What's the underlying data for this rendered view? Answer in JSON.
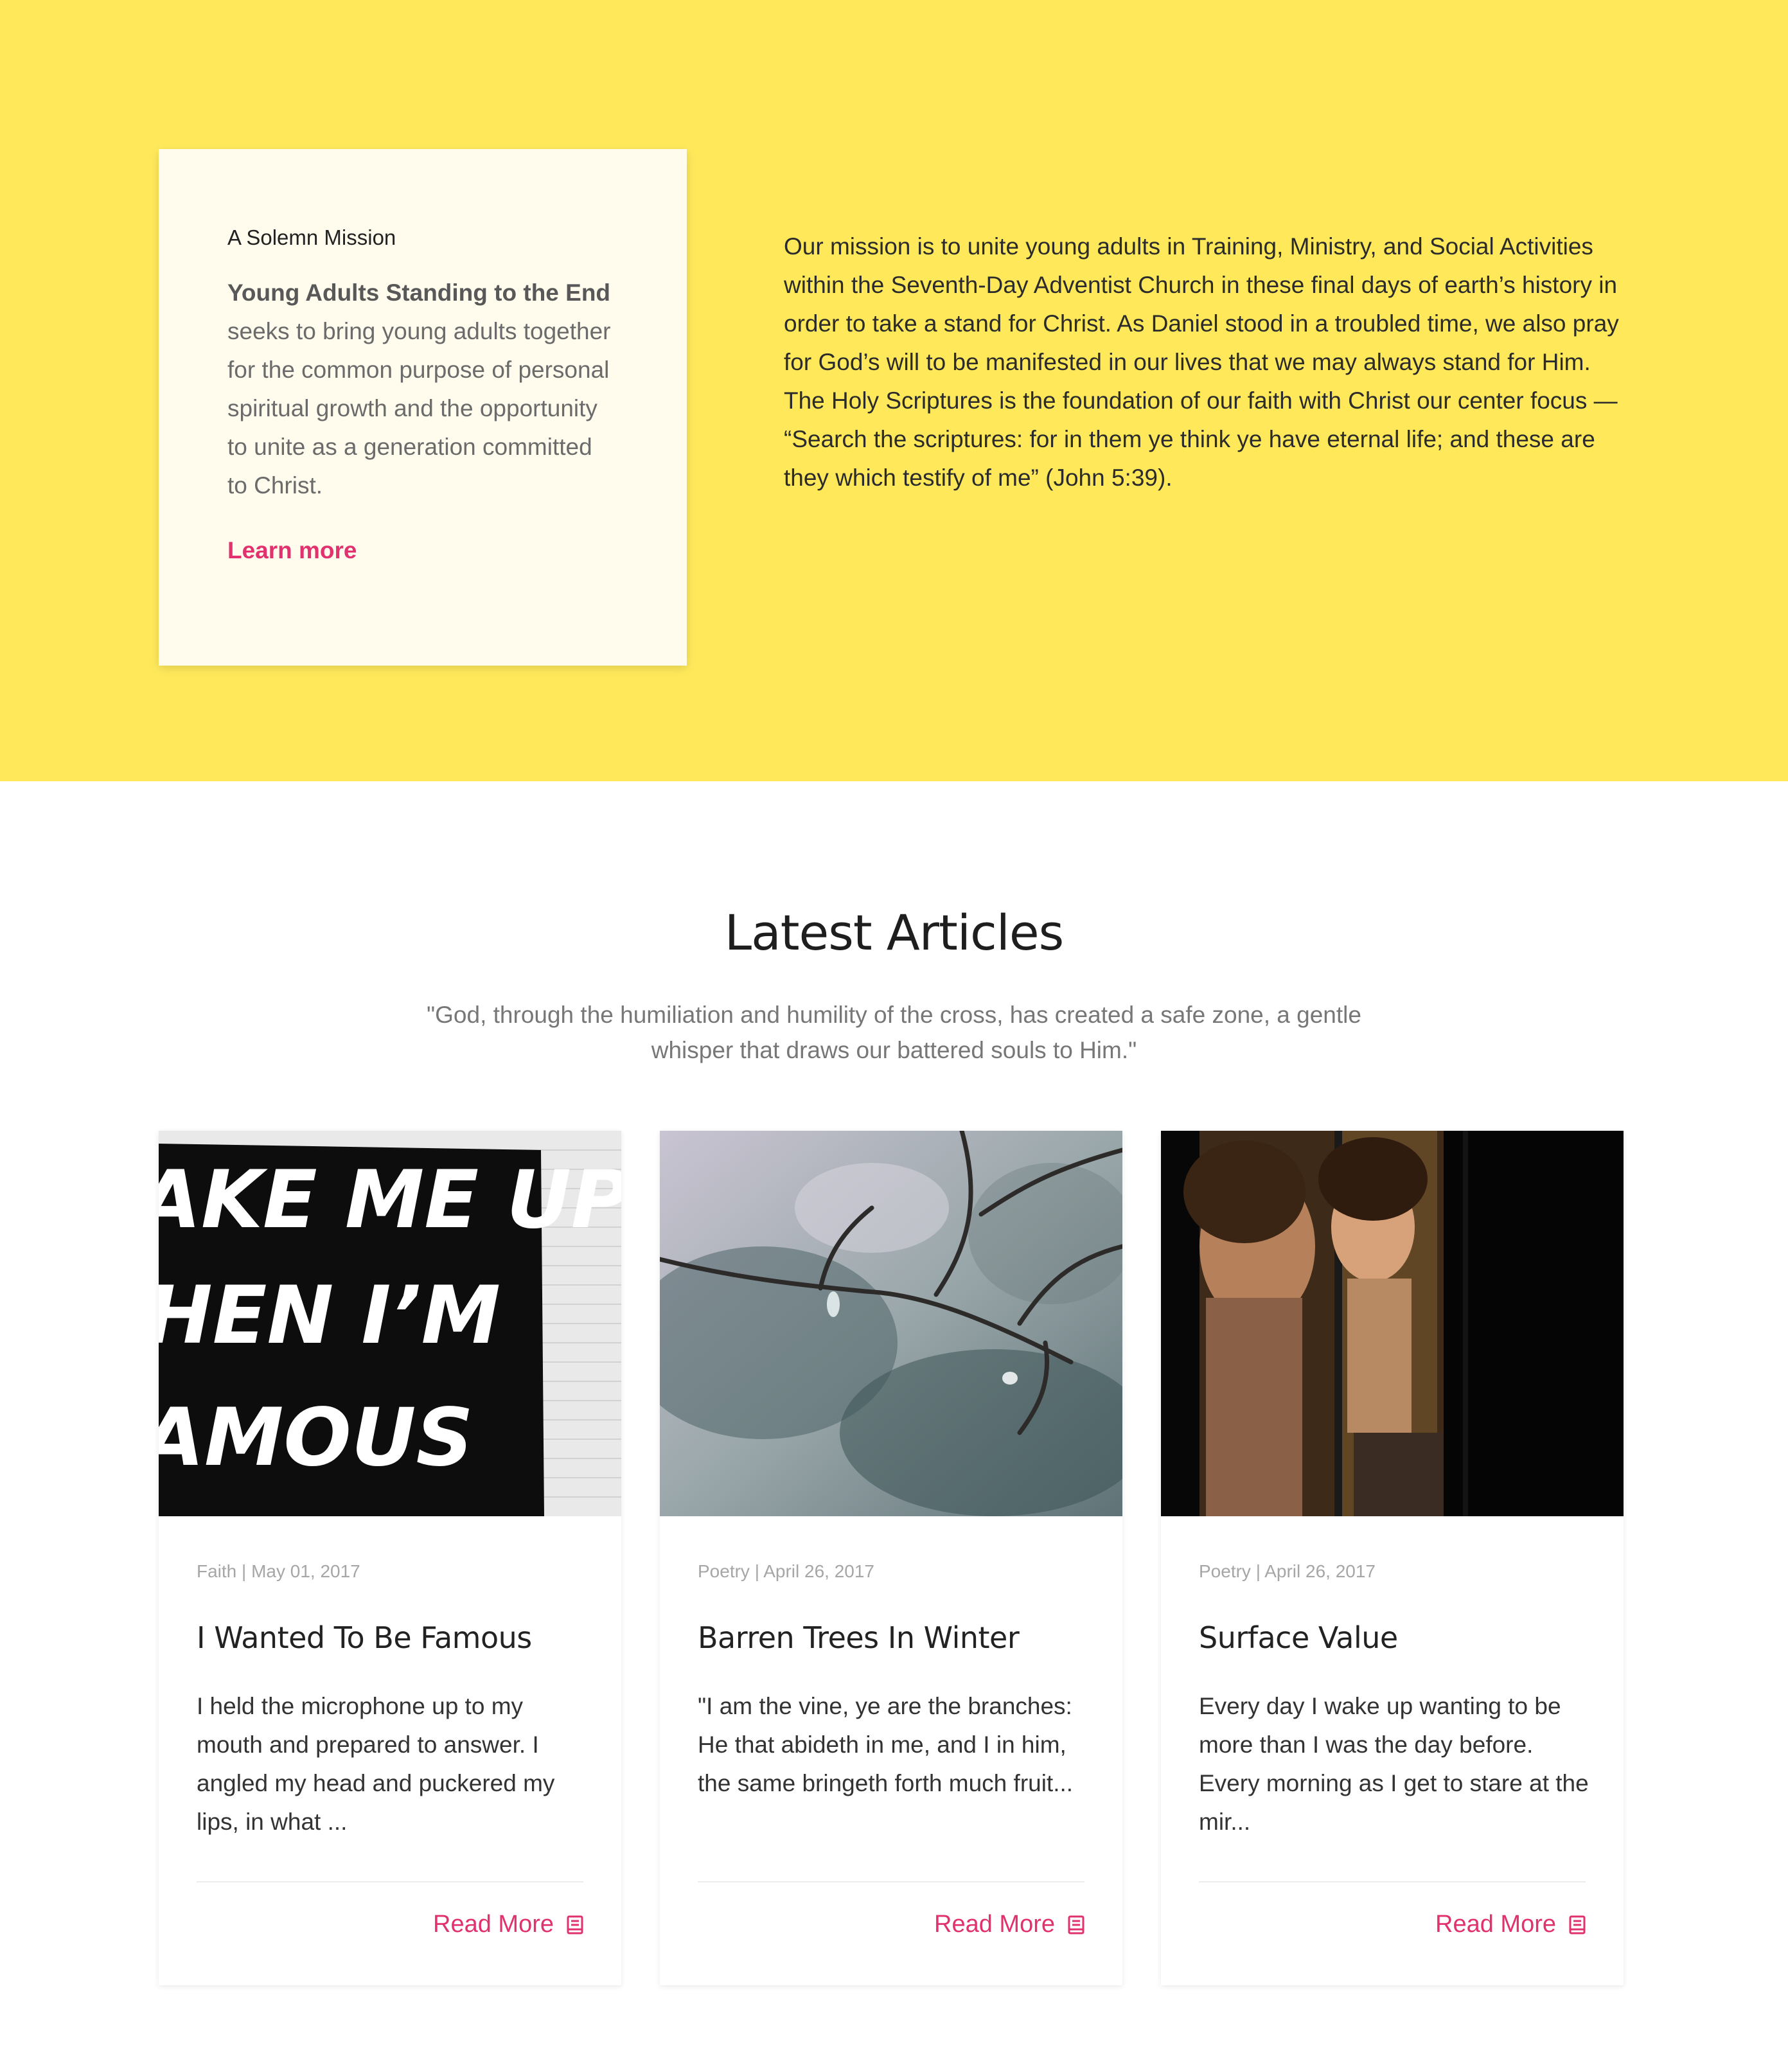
{
  "colors": {
    "hero_bg": "#ffe95b",
    "card_bg": "#fffced",
    "accent": "#e2316f"
  },
  "mission": {
    "eyebrow": "A Solemn Mission",
    "body_strong": "Young Adults Standing to the End",
    "body_rest": " seeks to bring young adults together for the common purpose of personal spiritual growth and the opportunity to unite as a generation committed to Christ.",
    "learn_more_label": "Learn more",
    "statement": "Our mission is to unite young adults in Training, Ministry, and Social Activities within the Seventh-Day Adventist Church in these final days of earth’s history in order to take a stand for Christ. As Daniel stood in a troubled time, we also pray for God’s will to be manifested in our lives that we may always stand for Him. The Holy Scriptures is the foundation of our faith with Christ our center focus — “Search the scriptures: for in them ye think ye have eternal life; and these are they which testify of me” (John 5:39)."
  },
  "latest": {
    "title": "Latest Articles",
    "quote": "\"God, through the humiliation and humility of the cross, has created a safe zone, a gentle whisper that draws our battered souls to Him.\""
  },
  "articles": [
    {
      "image": "wall-mural-photo",
      "image_text": [
        "AKE ME UP",
        "HEN I’M",
        "AMOUS"
      ],
      "meta": "Faith | May 01, 2017",
      "title": "I Wanted To Be Famous",
      "excerpt": "I held the microphone up to my mouth and prepared to answer. I angled my head and puckered my lips, in what ...",
      "read_more": "Read More",
      "icon": "book-icon"
    },
    {
      "image": "frozen-branches-photo",
      "meta": "Poetry | April 26, 2017",
      "title": "Barren Trees In Winter",
      "excerpt": "\"I am the vine, ye are the branches: He that abideth in me, and I in him, the same bringeth forth much fruit...",
      "read_more": "Read More",
      "icon": "book-icon"
    },
    {
      "image": "mirror-portrait-photo",
      "meta": "Poetry | April 26, 2017",
      "title": "Surface Value",
      "excerpt": "Every day I wake up wanting to be more than I was the day before. Every morning as I get to stare at the mir...",
      "read_more": "Read More",
      "icon": "book-icon"
    }
  ]
}
